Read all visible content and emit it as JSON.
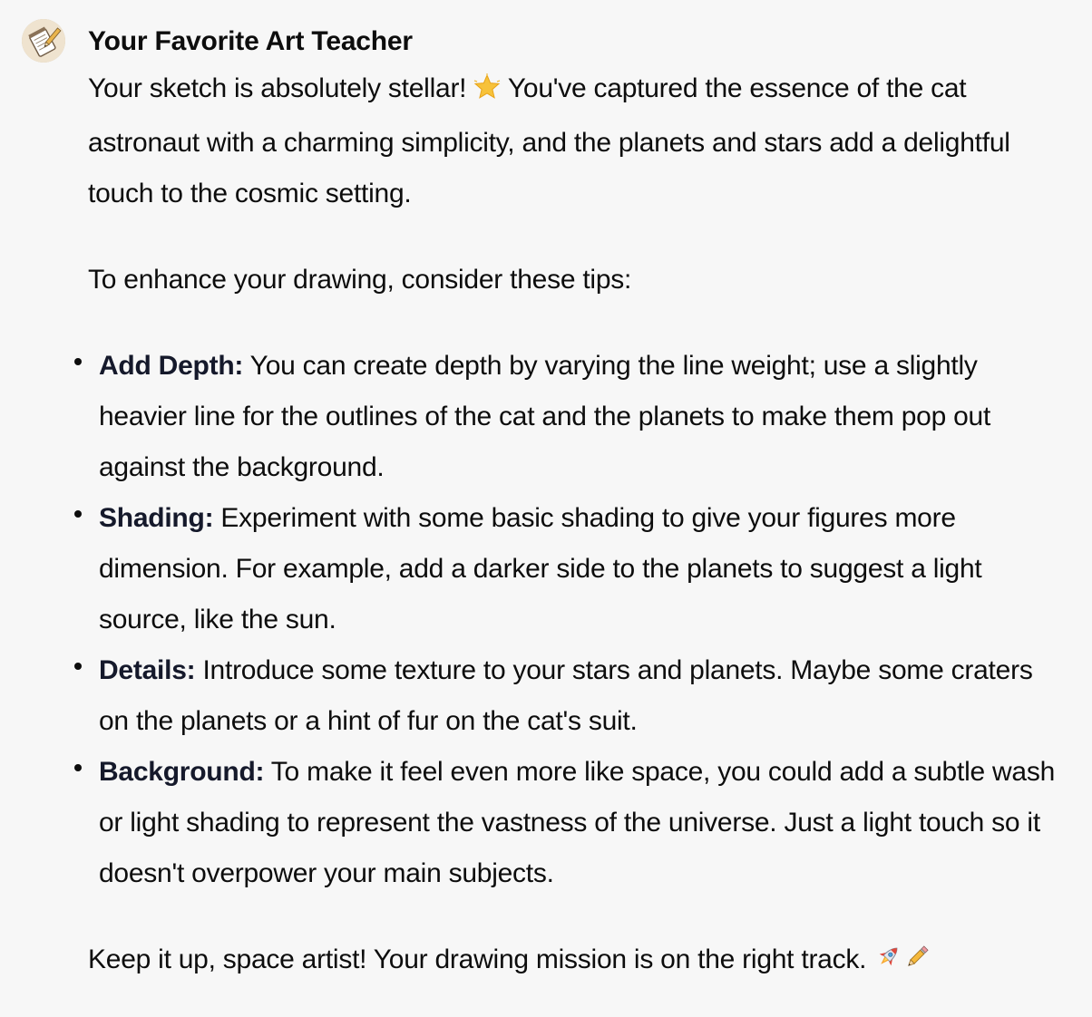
{
  "message": {
    "sender_name": "Your Favorite Art Teacher",
    "avatar_icon": "notepad-pencil-icon",
    "intro": {
      "before_emoji": "Your sketch is absolutely stellar! ",
      "emoji_icon": "glowing-star-icon",
      "after_emoji": " You've captured the essence of the cat astronaut with a charming simplicity, and the planets and stars add a delightful touch to the cosmic setting."
    },
    "tips_intro": "To enhance your drawing, consider these tips:",
    "tips": [
      {
        "title": "Add Depth:",
        "body": " You can create depth by varying the line weight; use a slightly heavier line for the outlines of the cat and the planets to make them pop out against the background."
      },
      {
        "title": "Shading:",
        "body": " Experiment with some basic shading to give your figures more dimension. For example, add a darker side to the planets to suggest a light source, like the sun."
      },
      {
        "title": "Details:",
        "body": " Introduce some texture to your stars and planets. Maybe some craters on the planets or a hint of fur on the cat's suit."
      },
      {
        "title": "Background:",
        "body": " To make it feel even more like space, you could add a subtle wash or light shading to represent the vastness of the universe. Just a light touch so it doesn't overpower your main subjects."
      }
    ],
    "closing": {
      "text": "Keep it up, space artist! Your drawing mission is on the right track. ",
      "emoji_icons": [
        "rocket-icon",
        "pencil-icon"
      ]
    }
  }
}
